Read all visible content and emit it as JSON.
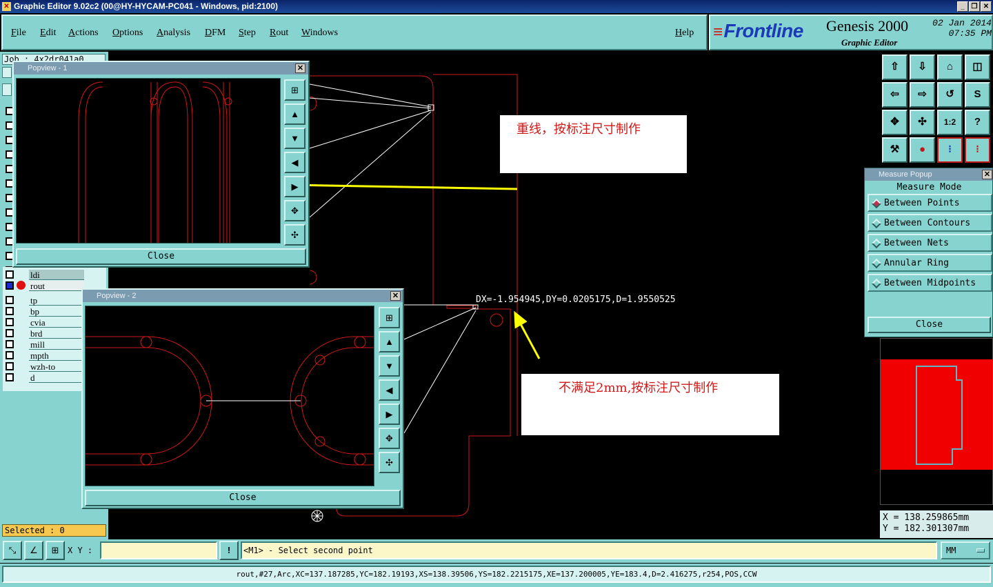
{
  "window": {
    "title": "Graphic Editor 9.02c2 (00@HY-HYCAM-PC041 - Windows, pid:2100)",
    "controls": [
      "_",
      "❐",
      "✕"
    ]
  },
  "menu": {
    "items": [
      "File",
      "Edit",
      "Actions",
      "Options",
      "Analysis",
      "DFM",
      "Step",
      "Rout",
      "Windows"
    ],
    "help": "Help"
  },
  "branding": {
    "logo": "Frontline",
    "product": "Genesis 2000",
    "subtitle": "Graphic Editor",
    "date": "02 Jan 2014",
    "time": "07:35 PM"
  },
  "left_panel": {
    "job_label": "Job : 4x2dr041a0",
    "layers": [
      "ldi",
      "rout",
      "tp",
      "bp",
      "cvia",
      "brd",
      "mill",
      "mpth",
      "wzh-to",
      "d"
    ],
    "active_layer": "rout",
    "selected": "Selected : 0"
  },
  "popview1": {
    "title": "Popview - 1",
    "close": "Close"
  },
  "popview2": {
    "title": "Popview - 2",
    "close": "Close"
  },
  "measure": {
    "title": "Measure Popup",
    "mode_label": "Measure Mode",
    "options": [
      "Between Points",
      "Between Contours",
      "Between Nets",
      "Annular Ring",
      "Between Midpoints"
    ],
    "selected": "Between Points",
    "close": "Close"
  },
  "canvas": {
    "measure_readout": "DX=-1.954945,DY=0.0205175,D=1.9550525",
    "note1": "重线，按标注尺寸制作",
    "note2": "不满足2mm,按标注尺寸制作",
    "colors": {
      "outline": "#d01818",
      "arrow": "#ffff00",
      "measure_line": "#ffffff"
    }
  },
  "coords": {
    "x": "X  =  138.259865mm",
    "y": "Y  =  182.301307mm"
  },
  "bottom": {
    "xy_label": "X Y :",
    "xy_value": "",
    "prompt": "<M1> - Select second point",
    "units": "MM"
  },
  "status": "rout,#27,Arc,XC=137.187285,YC=182.19193,XS=138.39506,YS=182.2215175,XE=137.200005,YE=183.4,D=2.416275,r254,POS,CCW"
}
